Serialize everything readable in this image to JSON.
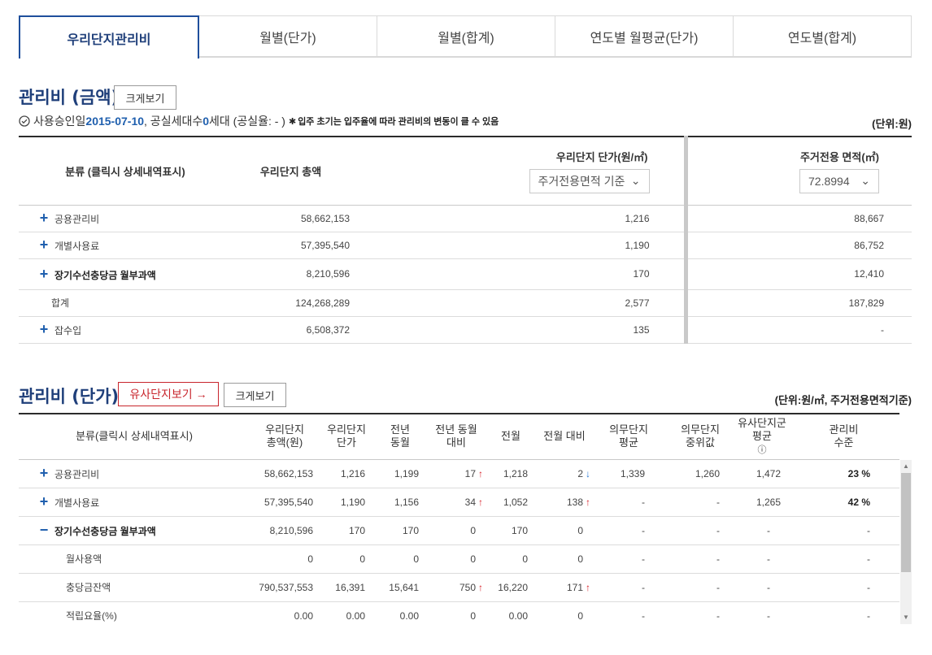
{
  "tabs": [
    "우리단지관리비",
    "월별(단가)",
    "월별(합계)",
    "연도별 월평균(단가)",
    "연도별(합계)"
  ],
  "sec1": {
    "title": "관리비 (금액)",
    "zoom_label": "크게보기",
    "info": {
      "prefix": "사용승인일 ",
      "date": "2015-07-10",
      "mid": ", 공실세대수 ",
      "vacant": "0",
      "suffix": "세대 (공실율: - )",
      "note": "입주 초기는 입주율에 따라 관리비의 변동이 클 수 있음"
    },
    "unit": "(단위:원)",
    "headers": {
      "cat": "분류 (클릭시 상세내역표시)",
      "total": "우리단지 총액",
      "unit_price": "우리단지 단가(원/㎡)",
      "unit_select": "주거전용면적 기준",
      "area": "주거전용 면적(㎡)",
      "area_select": "72.8994"
    },
    "rows": [
      {
        "label": "공용관리비",
        "total": "58,662,153",
        "price": "1,216",
        "area": "88,667"
      },
      {
        "label": "개별사용료",
        "total": "57,395,540",
        "price": "1,190",
        "area": "86,752"
      },
      {
        "label": "장기수선충당금 월부과액",
        "total": "8,210,596",
        "price": "170",
        "area": "12,410"
      },
      {
        "label": "합계",
        "total": "124,268,289",
        "price": "2,577",
        "area": "187,829"
      },
      {
        "label": "잡수입",
        "total": "6,508,372",
        "price": "135",
        "area": "-"
      }
    ]
  },
  "sec2": {
    "title": "관리비 (단가)",
    "similar_label": "유사단지보기 →",
    "zoom_label": "크게보기",
    "unit": "(단위:원/㎡, 주거전용면적기준)",
    "headers": [
      "분류(클릭시 상세내역표시)",
      "우리단지 총액(원)",
      "우리단지 단가",
      "전년 동월",
      "전년 동월 대비",
      "전월",
      "전월 대비",
      "의무단지 평균",
      "의무단지 중위값",
      "유사단지군 평균",
      "관리비 수준"
    ],
    "rows": [
      {
        "label": "공용관리비",
        "v": [
          "58,662,153",
          "1,216",
          "1,199",
          "17",
          "1,218",
          "2",
          "1,339",
          "1,260",
          "1,472",
          "23 %"
        ]
      },
      {
        "label": "개별사용료",
        "v": [
          "57,395,540",
          "1,190",
          "1,156",
          "34",
          "1,052",
          "138",
          "-",
          "-",
          "1,265",
          "42 %"
        ]
      },
      {
        "label": "장기수선충당금 월부과액",
        "v": [
          "8,210,596",
          "170",
          "170",
          "0",
          "170",
          "0",
          "-",
          "-",
          "-",
          "-"
        ]
      },
      {
        "label": "월사용액",
        "v": [
          "0",
          "0",
          "0",
          "0",
          "0",
          "0",
          "-",
          "-",
          "-",
          "-"
        ]
      },
      {
        "label": "충당금잔액",
        "v": [
          "790,537,553",
          "16,391",
          "15,641",
          "750",
          "16,220",
          "171",
          "-",
          "-",
          "-",
          "-"
        ]
      },
      {
        "label": "적립요율(%)",
        "v": [
          "0.00",
          "0.00",
          "0.00",
          "0",
          "0.00",
          "0",
          "-",
          "-",
          "-",
          "-"
        ]
      }
    ]
  }
}
